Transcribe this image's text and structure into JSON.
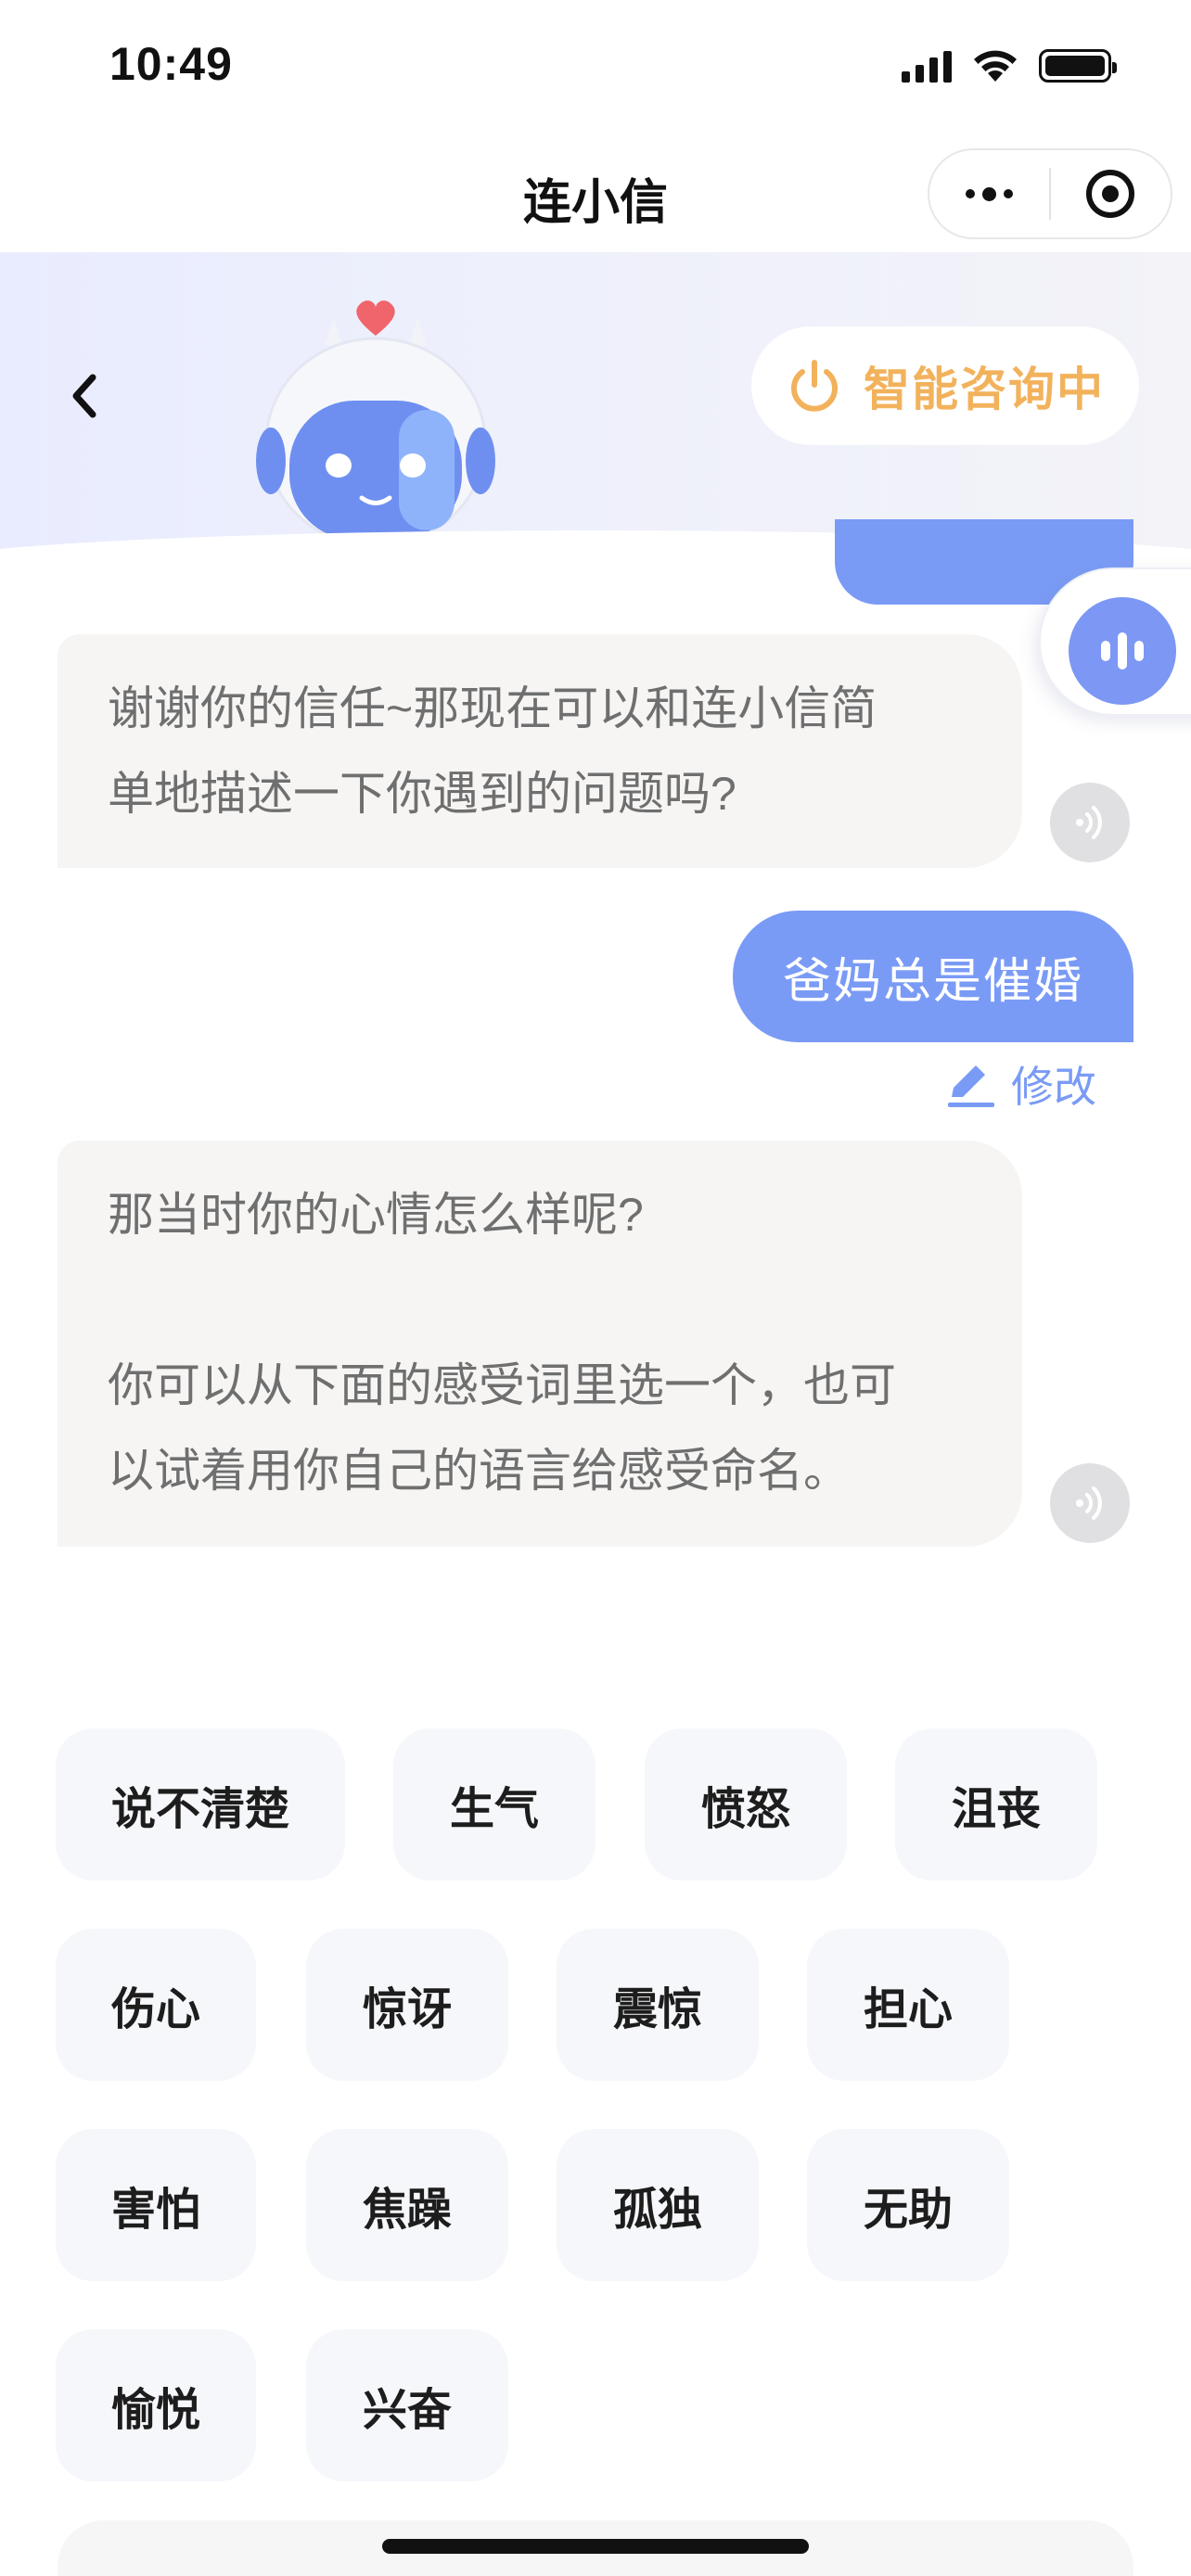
{
  "status_bar": {
    "time": "10:49"
  },
  "navbar": {
    "title": "连小信"
  },
  "banner": {
    "status_label": "智能咨询中"
  },
  "messages": [
    {
      "role": "bot",
      "lines": [
        "谢谢你的信任~那现在可以和连小信简",
        "单地描述一下你遇到的问题吗?"
      ]
    },
    {
      "role": "user",
      "text": "爸妈总是催婚",
      "edit_label": "修改"
    },
    {
      "role": "bot",
      "lines": [
        "那当时你的心情怎么样呢?",
        "",
        "你可以从下面的感受词里选一个，也可",
        "以试着用你自己的语言给感受命名。"
      ]
    }
  ],
  "emotion_chips": [
    "说不清楚",
    "生气",
    "愤怒",
    "沮丧",
    "伤心",
    "惊讶",
    "震惊",
    "担心",
    "害怕",
    "焦躁",
    "孤独",
    "无助",
    "愉悦",
    "兴奋"
  ],
  "colors": {
    "accent": "#7a9bf5",
    "status_orange": "#f2b25c",
    "bubble_bg": "#f6f5f4",
    "chip_bg": "#f6f7fb"
  },
  "icons": [
    "back-icon",
    "power-icon",
    "more-dots-icon",
    "target-icon",
    "voice-icon",
    "speaker-icon",
    "edit-icon",
    "robot-mascot-icon"
  ]
}
